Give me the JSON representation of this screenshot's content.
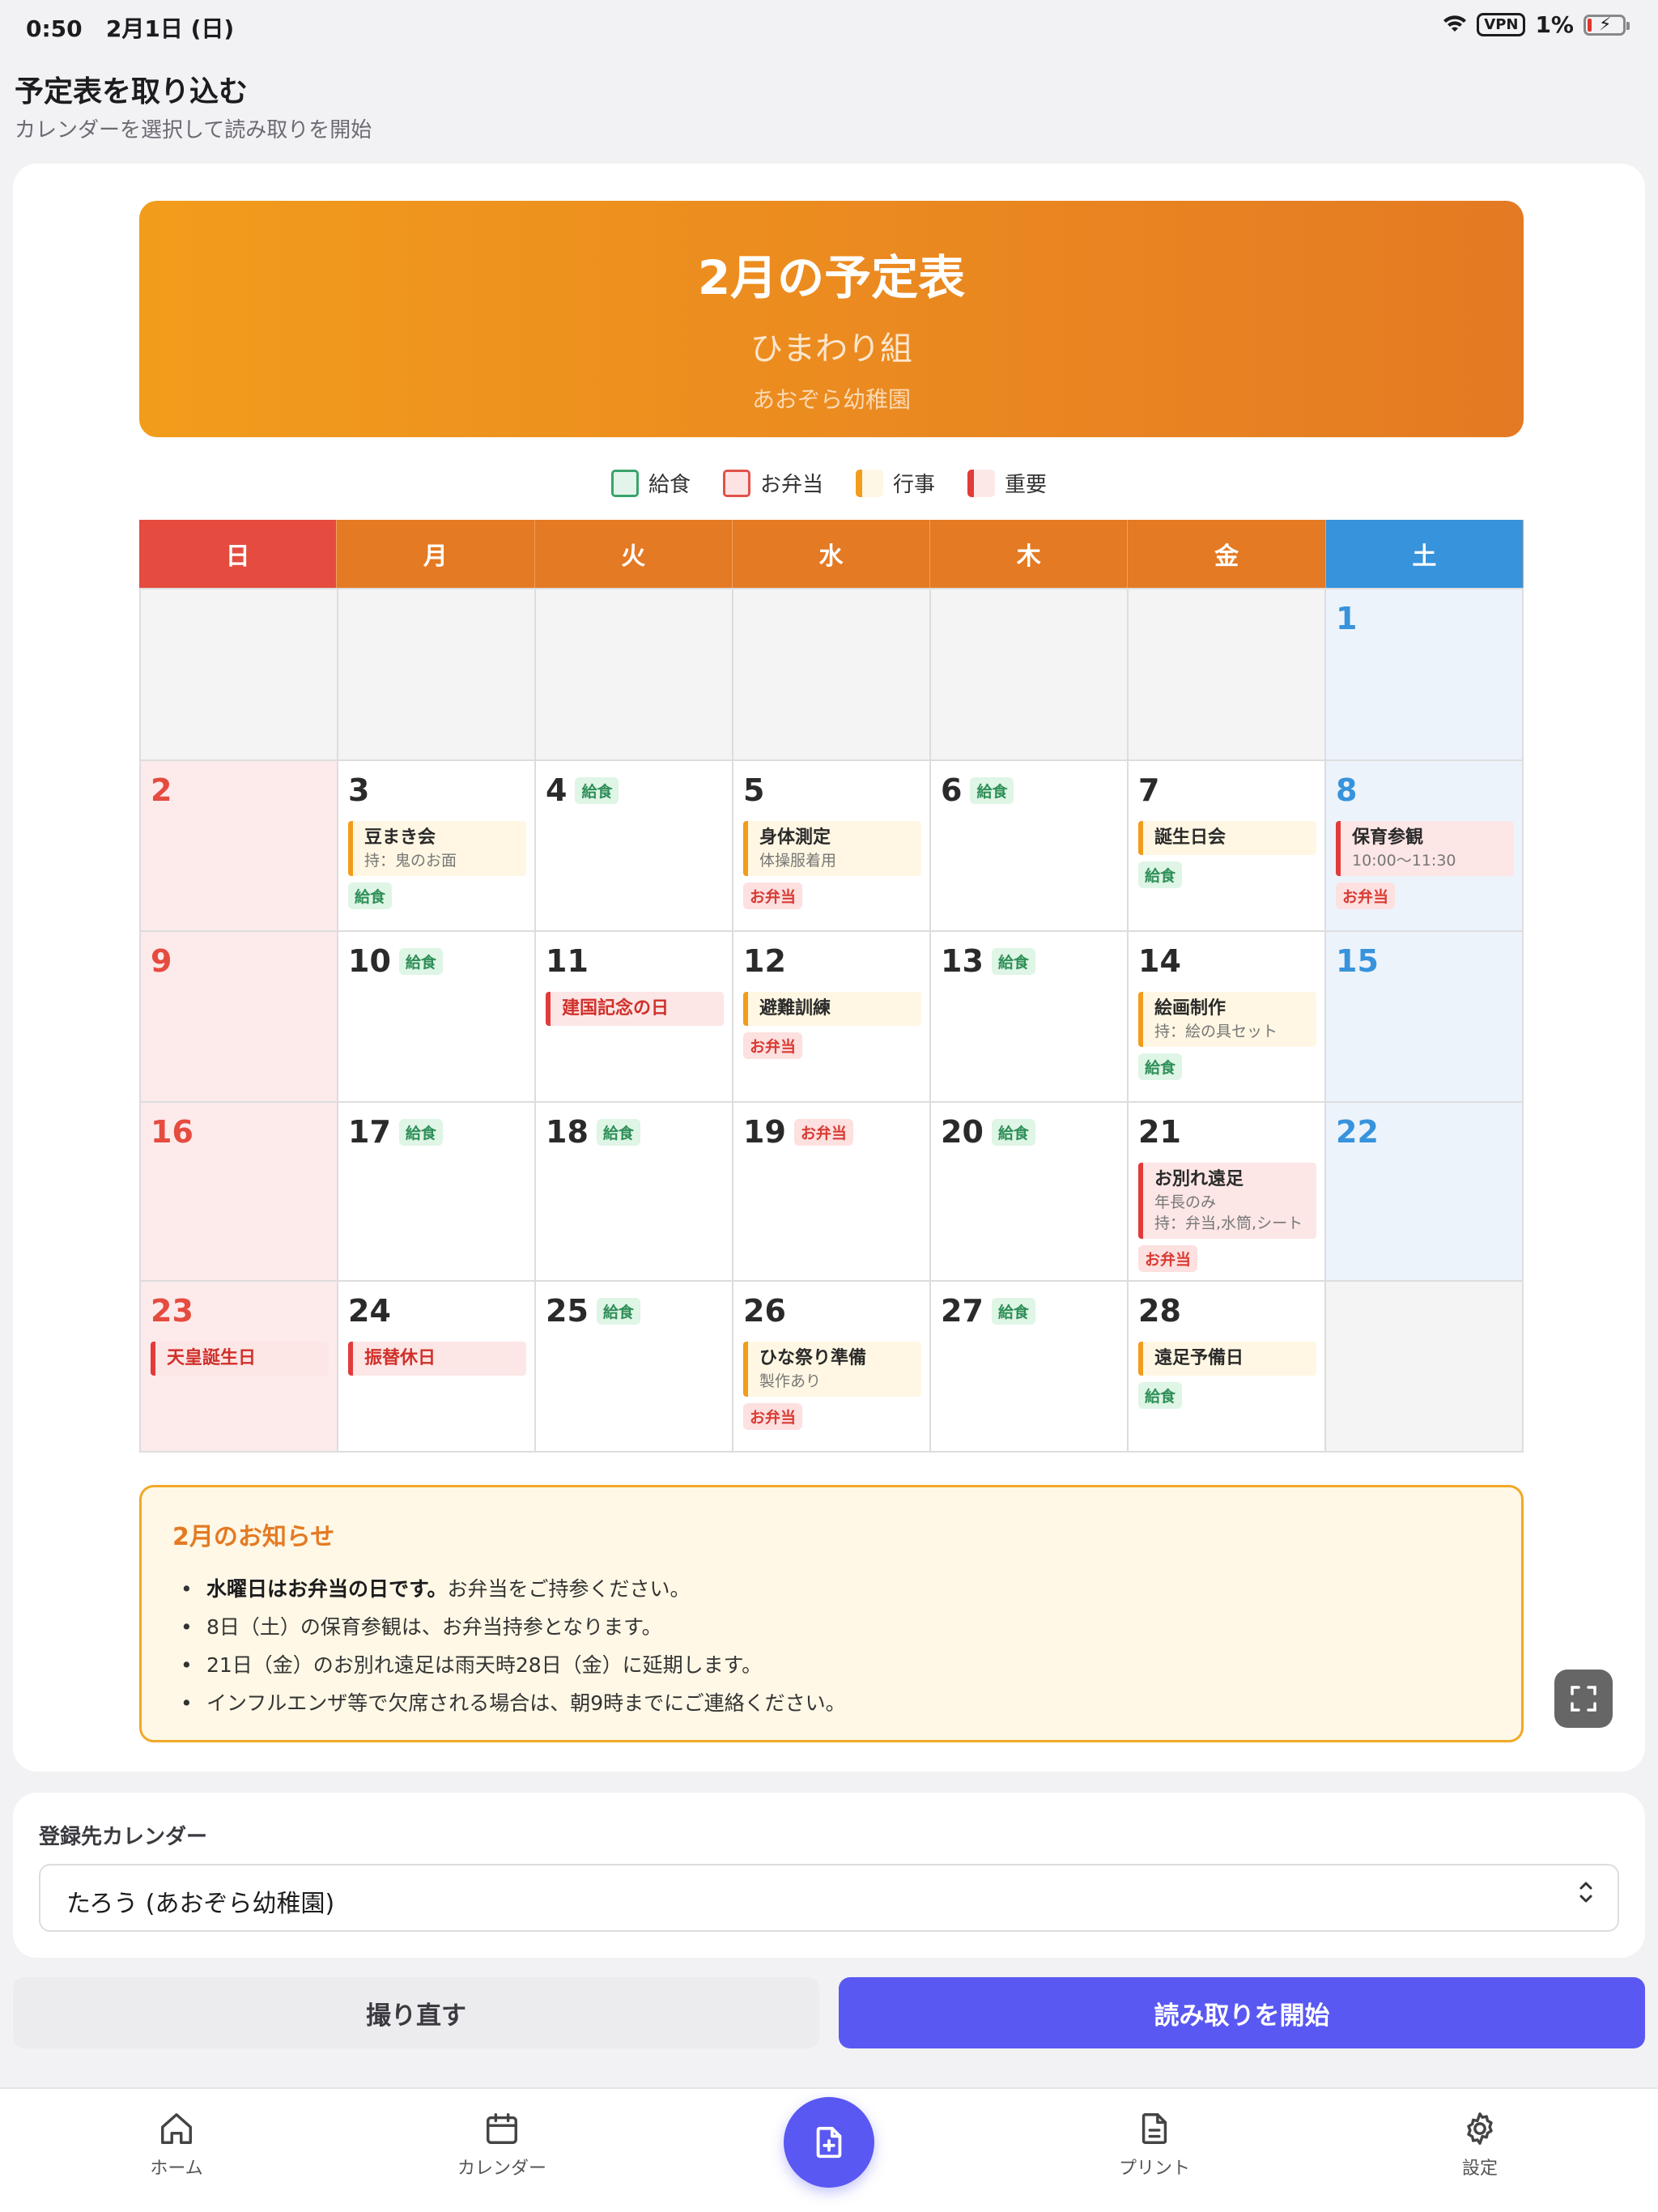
{
  "status": {
    "time": "0:50",
    "date": "2月1日 (日)",
    "vpn": "VPN",
    "battery": "1%"
  },
  "header": {
    "title": "予定表を取り込む",
    "subtitle": "カレンダーを選択して読み取りを開始"
  },
  "schedule": {
    "title": "2月の予定表",
    "class_name": "ひまわり組",
    "school": "あおぞら幼稚園",
    "legend": {
      "kyushoku": "給食",
      "obento": "お弁当",
      "gyoji": "行事",
      "juyo": "重要"
    },
    "weekdays": [
      "日",
      "月",
      "火",
      "水",
      "木",
      "金",
      "土"
    ],
    "days": {
      "d1": "1",
      "d2": "2",
      "d3": "3",
      "d4": "4",
      "d5": "5",
      "d6": "6",
      "d7": "7",
      "d8": "8",
      "d9": "9",
      "d10": "10",
      "d11": "11",
      "d12": "12",
      "d13": "13",
      "d14": "14",
      "d15": "15",
      "d16": "16",
      "d17": "17",
      "d18": "18",
      "d19": "19",
      "d20": "20",
      "d21": "21",
      "d22": "22",
      "d23": "23",
      "d24": "24",
      "d25": "25",
      "d26": "26",
      "d27": "27",
      "d28": "28"
    },
    "badges": {
      "kyushoku": "給食",
      "obento": "お弁当"
    },
    "events": {
      "e3": {
        "title": "豆まき会",
        "note": "持：鬼のお面"
      },
      "e5": {
        "title": "身体測定",
        "note": "体操服着用"
      },
      "e7": {
        "title": "誕生日会"
      },
      "e8": {
        "title": "保育参観",
        "note": "10:00〜11:30"
      },
      "e11": {
        "title": "建国記念の日"
      },
      "e12": {
        "title": "避難訓練"
      },
      "e14": {
        "title": "絵画制作",
        "note": "持：絵の具セット"
      },
      "e21": {
        "title": "お別れ遠足",
        "note1": "年長のみ",
        "note2": "持：弁当,水筒,シート"
      },
      "e23": {
        "title": "天皇誕生日"
      },
      "e24": {
        "title": "振替休日"
      },
      "e26": {
        "title": "ひな祭り準備",
        "note": "製作あり"
      },
      "e28": {
        "title": "遠足予備日"
      }
    }
  },
  "notice": {
    "title": "2月のお知らせ",
    "item1_bold": "水曜日はお弁当の日です。",
    "item1_rest": "お弁当をご持参ください。",
    "item2": "8日（土）の保育参観は、お弁当持参となります。",
    "item3": "21日（金）のお別れ遠足は雨天時28日（金）に延期します。",
    "item4": "インフルエンザ等で欠席される場合は、朝9時までにご連絡ください。"
  },
  "calendar_select": {
    "label": "登録先カレンダー",
    "value": "たろう (あおぞら幼稚園)"
  },
  "buttons": {
    "retake": "撮り直す",
    "start": "読み取りを開始"
  },
  "tabbar": {
    "home": "ホーム",
    "calendar": "カレンダー",
    "print": "プリント",
    "settings": "設定"
  },
  "colors": {
    "accent": "#5a58f2",
    "banner": "#e47a23",
    "sunday": "#e54b3f",
    "saturday": "#3793dc"
  }
}
